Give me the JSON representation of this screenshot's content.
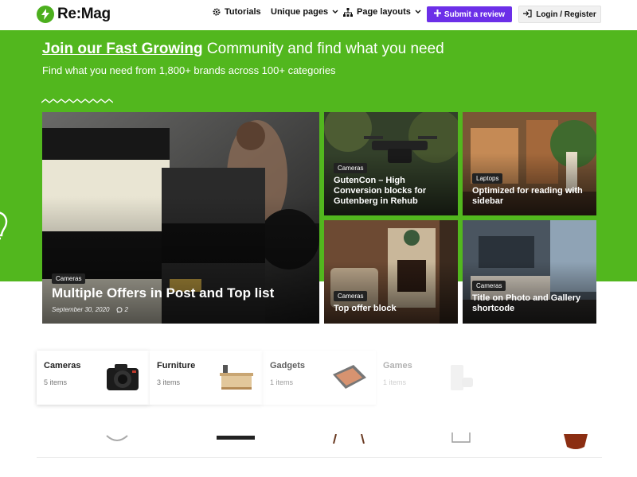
{
  "header": {
    "logo_text": "Re:Mag",
    "nav": [
      {
        "label": "Tutorials",
        "icon": "gear-icon"
      },
      {
        "label": "Unique pages",
        "icon": "chevron-down-icon"
      },
      {
        "label": "Page layouts",
        "icon": "sitemap-icon"
      }
    ],
    "review_label": "Submit a review",
    "login_label": "Login / Register"
  },
  "hero": {
    "title_strong": "Join our Fast Growing",
    "title_rest": " Community and find what you need",
    "subtitle": "Find what you need from 1,800+ brands across 100+ categories"
  },
  "featured": [
    {
      "category": "Cameras",
      "title": "Multiple Offers in Post and Top list",
      "date": "September 30, 2020",
      "comments": "2"
    },
    {
      "category": "Cameras",
      "title": "GutenCon – High Conversion blocks for Gutenberg in Rehub"
    },
    {
      "category": "Laptops",
      "title": "Optimized for reading with sidebar"
    },
    {
      "category": "Cameras",
      "title": "Top offer block"
    },
    {
      "category": "Cameras",
      "title": "Title on Photo and Gallery shortcode"
    }
  ],
  "categories": [
    {
      "name": "Cameras",
      "count": "5 items",
      "icon": "camera-icon"
    },
    {
      "name": "Furniture",
      "count": "3 items",
      "icon": "table-icon"
    },
    {
      "name": "Gadgets",
      "count": "1 items",
      "icon": "tablet-icon"
    },
    {
      "name": "Games",
      "count": "1 items",
      "icon": "console-icon"
    }
  ],
  "colors": {
    "brand_green": "#52b71e",
    "accent_purple": "#6c2fe8"
  }
}
